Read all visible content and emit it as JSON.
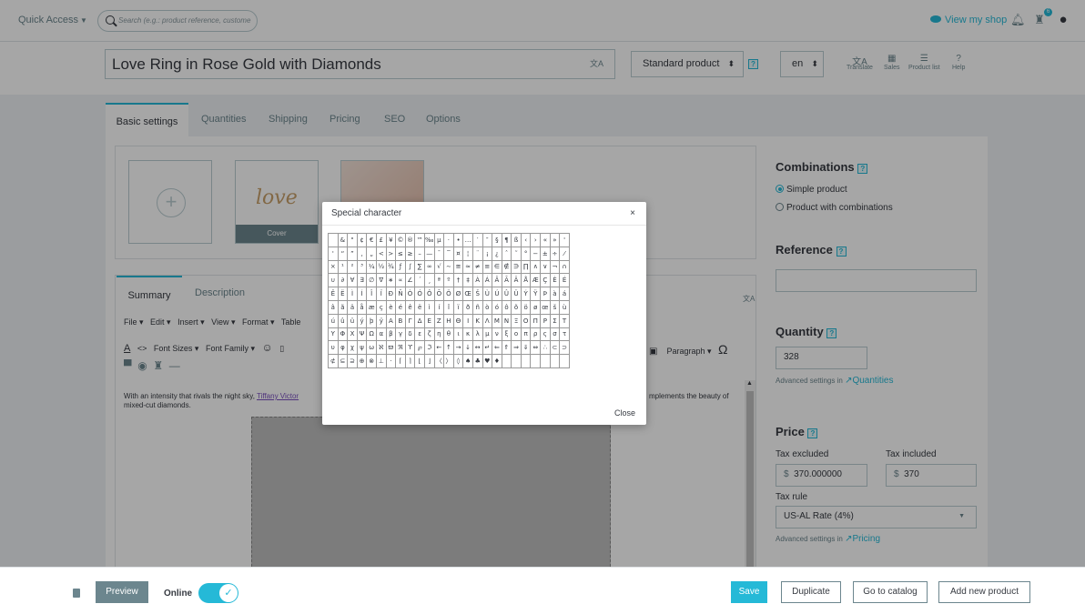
{
  "topbar": {
    "quick_access": "Quick Access",
    "search_placeholder": "Search (e.g.: product reference, custome",
    "view_shop": "View my shop",
    "badge_count": "6"
  },
  "product": {
    "name": "Love Ring in Rose Gold with Diamonds",
    "type": "Standard product",
    "lang": "en"
  },
  "tools": {
    "translate": "Translate",
    "sales": "Sales",
    "product_list": "Product list",
    "help": "Help"
  },
  "tabs": [
    "Basic settings",
    "Quantities",
    "Shipping",
    "Pricing",
    "SEO",
    "Options"
  ],
  "images": {
    "cover_label": "Cover"
  },
  "summary": {
    "tab_summary": "Summary",
    "tab_description": "Description",
    "menu": [
      "File ▾",
      "Edit ▾",
      "Insert ▾",
      "View ▾",
      "Format ▾",
      "Table"
    ],
    "font_sizes": "Font Sizes ▾",
    "font_family": "Font Family ▾",
    "paragraph": "Paragraph ▾",
    "text_pre": "With an intensity that rivals the night sky, ",
    "text_link": "Tiffany Victor",
    "text_right": "mplements the beauty of",
    "text_line2": "mixed-cut diamonds."
  },
  "sidebar": {
    "combinations_title": "Combinations",
    "simple_product": "Simple product",
    "product_with_combinations": "Product with combinations",
    "reference_title": "Reference",
    "quantity_title": "Quantity",
    "quantity_value": "328",
    "adv_settings_in": "Advanced settings in",
    "quantities_link": "Quantities",
    "price_title": "Price",
    "tax_excluded": "Tax excluded",
    "tax_included": "Tax included",
    "currency": "$",
    "price_excl": "370.000000",
    "price_incl": "370",
    "tax_rule_label": "Tax rule",
    "tax_rule": "US-AL Rate (4%)",
    "pricing_link": "Pricing"
  },
  "footer": {
    "preview": "Preview",
    "online": "Online",
    "save": "Save",
    "duplicate": "Duplicate",
    "go_to_catalog": "Go to catalog",
    "add_new_product": "Add new product"
  },
  "modal": {
    "title": "Special character",
    "close_x": "×",
    "close": "Close",
    "rows": [
      [
        "",
        "&",
        "\"",
        "¢",
        "€",
        "£",
        "¥",
        "©",
        "®",
        "™",
        "‰",
        "µ",
        "·",
        "•",
        "…",
        "′",
        "″",
        "§",
        "¶",
        "ß",
        "‹",
        "›",
        "«",
        "»",
        "'"
      ],
      [
        "'",
        "“",
        "”",
        "‚",
        "„",
        "<",
        ">",
        "≤",
        "≥",
        "–",
        "—",
        "¯",
        "‾",
        "¤",
        "¦",
        "¨",
        "¡",
        "¿",
        "ˆ",
        "˜",
        "°",
        "−",
        "±",
        "÷",
        "⁄"
      ],
      [
        "×",
        "¹",
        "²",
        "³",
        "¼",
        "½",
        "¾",
        "ƒ",
        "∫",
        "∑",
        "∞",
        "√",
        "∼",
        "≅",
        "≈",
        "≠",
        "≡",
        "∈",
        "∉",
        "∋",
        "∏",
        "∧",
        "∨",
        "¬",
        "∩"
      ],
      [
        "∪",
        "∂",
        "∀",
        "∃",
        "∅",
        "∇",
        "∗",
        "∝",
        "∠",
        "´",
        "¸",
        "ª",
        "º",
        "†",
        "‡",
        "À",
        "Á",
        "Â",
        "Ã",
        "Ä",
        "Å",
        "Æ",
        "Ç",
        "È",
        "É"
      ],
      [
        "Ê",
        "Ë",
        "Ì",
        "Í",
        "Î",
        "Ï",
        "Ð",
        "Ñ",
        "Ò",
        "Ó",
        "Ô",
        "Õ",
        "Ö",
        "Ø",
        "Œ",
        "Š",
        "Ù",
        "Ú",
        "Û",
        "Ü",
        "Ý",
        "Ÿ",
        "Þ",
        "à",
        "á"
      ],
      [
        "â",
        "ã",
        "ä",
        "å",
        "æ",
        "ç",
        "è",
        "é",
        "ê",
        "ë",
        "ì",
        "í",
        "î",
        "ï",
        "ð",
        "ñ",
        "ò",
        "ó",
        "ô",
        "õ",
        "ö",
        "ø",
        "œ",
        "š",
        "ù"
      ],
      [
        "ú",
        "û",
        "ü",
        "ý",
        "þ",
        "ÿ",
        "Α",
        "Β",
        "Γ",
        "Δ",
        "Ε",
        "Ζ",
        "Η",
        "Θ",
        "Ι",
        "Κ",
        "Λ",
        "Μ",
        "Ν",
        "Ξ",
        "Ο",
        "Π",
        "Ρ",
        "Σ",
        "Τ"
      ],
      [
        "Υ",
        "Φ",
        "Χ",
        "Ψ",
        "Ω",
        "α",
        "β",
        "γ",
        "δ",
        "ε",
        "ζ",
        "η",
        "θ",
        "ι",
        "κ",
        "λ",
        "μ",
        "ν",
        "ξ",
        "ο",
        "π",
        "ρ",
        "ς",
        "σ",
        "τ"
      ],
      [
        "υ",
        "φ",
        "χ",
        "ψ",
        "ω",
        "ℵ",
        "ϖ",
        "ℜ",
        "ϒ",
        "℘",
        "ℑ",
        "←",
        "↑",
        "→",
        "↓",
        "↔",
        "↵",
        "⇐",
        "⇑",
        "⇒",
        "⇓",
        "⇔",
        "∴",
        "⊂",
        "⊃"
      ],
      [
        "⊄",
        "⊆",
        "⊇",
        "⊕",
        "⊗",
        "⊥",
        "⋅",
        "⌈",
        "⌉",
        "⌊",
        "⌋",
        "〈",
        "〉",
        "◊",
        "♠",
        "♣",
        "♥",
        "♦",
        "",
        "",
        "",
        "",
        "",
        "",
        ""
      ]
    ]
  },
  "colors": {
    "accent": "#25b9d7",
    "text": "#363a41",
    "muted": "#6c868e"
  }
}
